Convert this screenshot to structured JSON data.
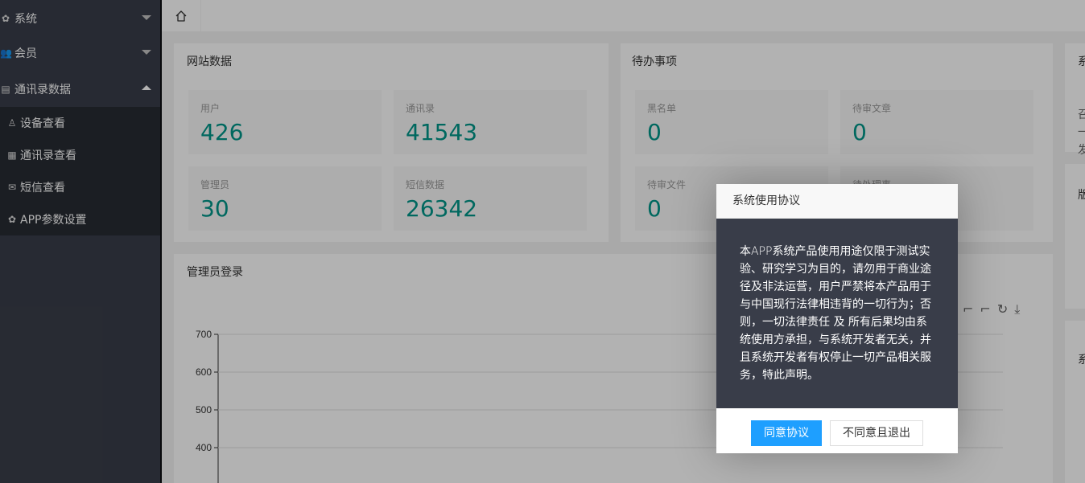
{
  "sidebar": {
    "items": [
      {
        "label": "系统",
        "icon": "gear-icon"
      },
      {
        "label": "会员",
        "icon": "users-icon"
      },
      {
        "label": "通讯录数据",
        "icon": "id-card-icon"
      }
    ],
    "sub_items": [
      {
        "label": "设备查看",
        "icon": "user-icon"
      },
      {
        "label": "通讯录查看",
        "icon": "building-icon"
      },
      {
        "label": "短信查看",
        "icon": "envelope-icon"
      },
      {
        "label": "APP参数设置",
        "icon": "gear-icon"
      }
    ]
  },
  "tabs": {
    "home_icon": "home-icon"
  },
  "dashboard": {
    "site_data": {
      "title": "网站数据",
      "stats": [
        {
          "label": "用户",
          "value": "426"
        },
        {
          "label": "通讯录",
          "value": "41543"
        },
        {
          "label": "管理员",
          "value": "30"
        },
        {
          "label": "短信数据",
          "value": "26342"
        }
      ]
    },
    "todo": {
      "title": "待办事项",
      "stats": [
        {
          "label": "黑名单",
          "value": "0"
        },
        {
          "label": "待审文章",
          "value": "0"
        },
        {
          "label": "待审文件",
          "value": "0"
        },
        {
          "label": "待处理事",
          "value": ""
        }
      ]
    },
    "right_partial": {
      "title": "系",
      "lines": [
        "召",
        "一",
        "发"
      ],
      "title2": "版",
      "title3": "系"
    },
    "admin_login": {
      "title": "管理员登录"
    }
  },
  "chart_data": {
    "type": "line",
    "title": "管理员登录",
    "y_ticks": [
      "700",
      "600",
      "500",
      "400"
    ],
    "ylim": [
      400,
      700
    ],
    "series": []
  },
  "dialog": {
    "title": "系统使用协议",
    "body": "本APP系统产品使用用途仅限于测试实验、研究学习为目的，请勿用于商业途径及非法运营，用户严禁将本产品用于与中国现行法律相违背的一切行为；否则，一切法律责任 及 所有后果均由系统使用方承担，与系统开发者无关，并且系统开发者有权停止一切产品相关服务，特此声明。",
    "agree": "同意协议",
    "disagree": "不同意且退出"
  },
  "colors": {
    "accent": "#009688",
    "primary_button": "#1e9fff",
    "sidebar": "#393d49"
  }
}
